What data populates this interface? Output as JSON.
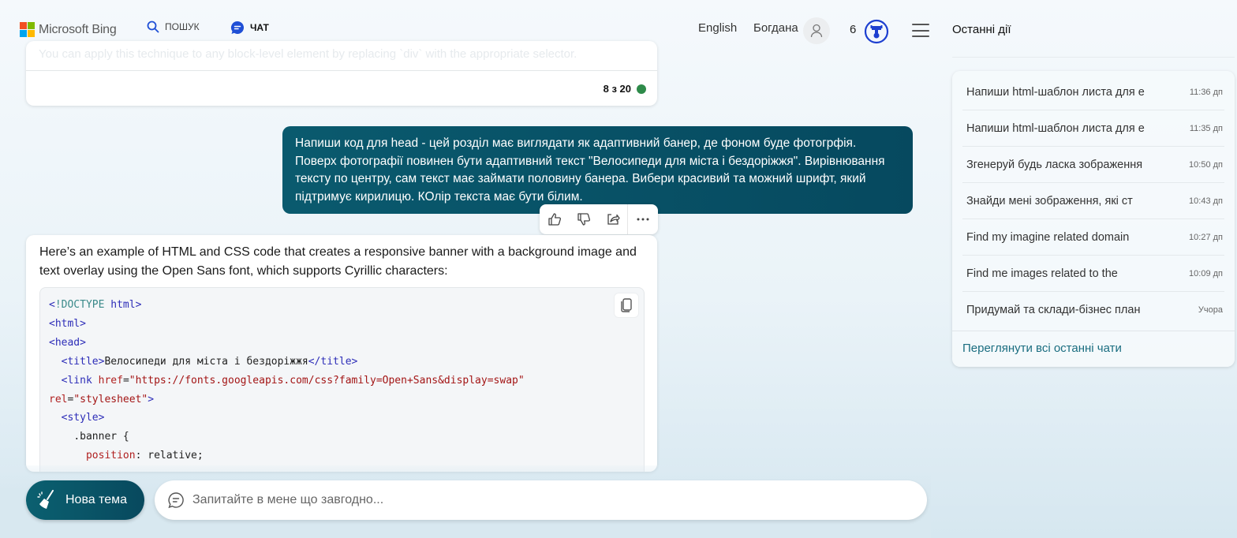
{
  "header": {
    "brand": "Microsoft Bing",
    "brand_colors": [
      "#f25022",
      "#7fba00",
      "#00a4ef",
      "#ffb900"
    ],
    "tabs": [
      {
        "label": "ПОШУК",
        "icon": "search-icon",
        "active": false
      },
      {
        "label": "ЧАТ",
        "icon": "chat-icon",
        "active": true
      }
    ],
    "language": "English",
    "user_name": "Богдана",
    "rewards_count": "6",
    "recent_title": "Останні дії",
    "accent_color": "#174ae4"
  },
  "previous_card": {
    "faded_text": "You can apply this technique to any block-level element by replacing `div` with the appropriate selector.",
    "turn_counter": "8 з 20",
    "status_color": "#2e8b4a"
  },
  "user_message": {
    "text": "Напиши код для head - цей розділ має виглядати як адаптивний банер, де фоном буде фотогрфія. Поверх фотографії повинен бути адаптивний текст \"Велосипеди для міста і бездоріжжя\". Вирівнювання тексту по центру, сам текст має займати половину банера. Вибери красивий та можний шрифт, який підтримує кирилицю. КОлір текста має бути білим."
  },
  "feedback": {
    "like": "thumbs-up-icon",
    "dislike": "thumbs-down-icon",
    "share": "share-icon",
    "more": "more-icon"
  },
  "bot_message": {
    "intro": "Here’s an example of HTML and CSS code that creates a responsive banner with a background image and text overlay using the Open Sans font, which supports Cyrillic characters:",
    "code_lines": [
      {
        "indent": "",
        "parts": [
          [
            "tag",
            "<"
          ],
          [
            "kw",
            "!DOCTYPE"
          ],
          [
            "tag",
            " html>"
          ]
        ]
      },
      {
        "indent": "",
        "parts": [
          [
            "tag",
            "<html>"
          ]
        ]
      },
      {
        "indent": "",
        "parts": [
          [
            "tag",
            "<head>"
          ]
        ]
      },
      {
        "indent": "  ",
        "parts": [
          [
            "tag",
            "<title>"
          ],
          [
            "txt",
            "Велосипеди для міста і бездоріжжя"
          ],
          [
            "tag",
            "</title>"
          ]
        ]
      },
      {
        "indent": "  ",
        "parts": [
          [
            "tag",
            "<link "
          ],
          [
            "attr",
            "href"
          ],
          [
            "txt",
            "="
          ],
          [
            "str",
            "\"https://fonts.googleapis.com/css?family=Open+Sans&display=swap\""
          ]
        ]
      },
      {
        "indent": "",
        "parts": [
          [
            "attr",
            "rel"
          ],
          [
            "txt",
            "="
          ],
          [
            "str",
            "\"stylesheet\""
          ],
          [
            "tag",
            ">"
          ]
        ]
      },
      {
        "indent": "  ",
        "parts": [
          [
            "tag",
            "<style>"
          ]
        ]
      },
      {
        "indent": "    ",
        "parts": [
          [
            "txt",
            ".banner {"
          ]
        ]
      },
      {
        "indent": "      ",
        "parts": [
          [
            "prop",
            "position"
          ],
          [
            "txt",
            ": relative;"
          ]
        ]
      }
    ]
  },
  "bottom_bar": {
    "new_topic_label": "Нова тема",
    "input_placeholder": "Запитайте в мене що завгодно...",
    "input_value": ""
  },
  "recent_chats": {
    "items": [
      {
        "title": "Напиши html-шаблон листа для е",
        "time": "11:36 дп"
      },
      {
        "title": "Напиши html-шаблон листа для е",
        "time": "11:35 дп"
      },
      {
        "title": "Згенеруй будь ласка зображення",
        "time": "10:50 дп"
      },
      {
        "title": "Знайди мені зображення, які ст",
        "time": "10:43 дп"
      },
      {
        "title": "Find my imagine related domain",
        "time": "10:27 дп"
      },
      {
        "title": "Find me images related to the",
        "time": "10:09 дп"
      },
      {
        "title": "Придумай та склади-бізнес план",
        "time": "Учора"
      }
    ],
    "see_all": "Переглянути всі останні чати"
  }
}
